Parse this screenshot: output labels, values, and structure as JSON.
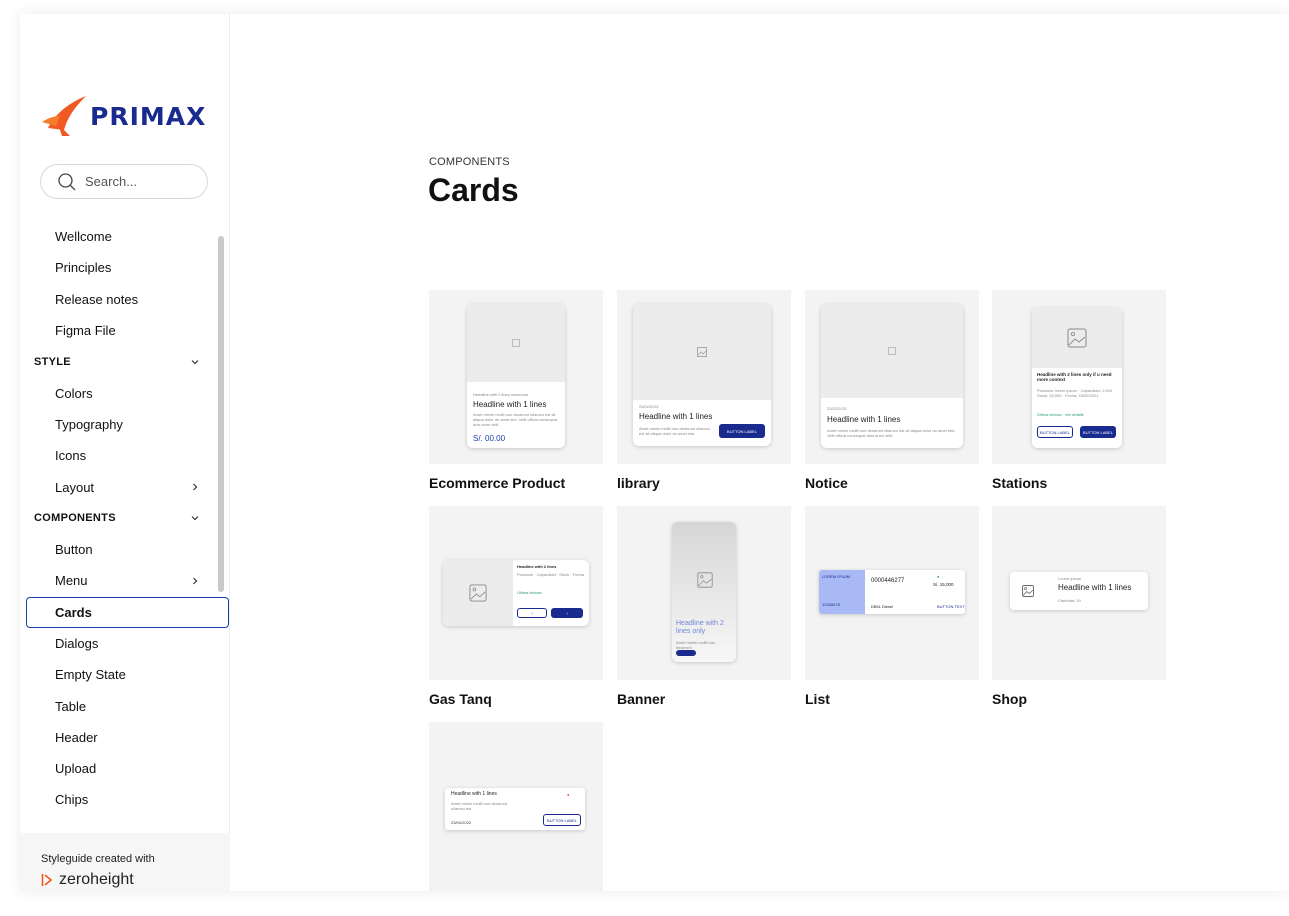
{
  "brand": {
    "name": "PRIMAX",
    "color": "#1a2b8f",
    "accent": "#f05a22"
  },
  "search": {
    "placeholder": "Search..."
  },
  "nav": {
    "intro": [
      "Wellcome",
      "Principles",
      "Release notes",
      "Figma File"
    ],
    "style_label": "STYLE",
    "style_items": [
      "Colors",
      "Typography",
      "Icons",
      "Layout"
    ],
    "components_label": "COMPONENTS",
    "component_items": [
      "Button",
      "Menu",
      "Cards",
      "Dialogs",
      "Empty State",
      "Table",
      "Header",
      "Upload",
      "Chips"
    ],
    "active": "Cards"
  },
  "footer": {
    "note": "Styleguide created with",
    "product": "zeroheight"
  },
  "page": {
    "eyebrow": "COMPONENTS",
    "title": "Cards"
  },
  "tiles": [
    {
      "label": "Ecommerce Product",
      "headline": "Headline with 1 lines",
      "price": "S/. 00.00"
    },
    {
      "label": "library",
      "headline": "Headline with 1 lines",
      "date": "23/02/2021",
      "button": "BUTTON LABEL"
    },
    {
      "label": "Notice",
      "headline": "Headline with 1 lines",
      "date": "23/02/2021"
    },
    {
      "label": "Stations",
      "headline": "Headline with 2 lines only if u need more context",
      "button_outline": "BUTTON LABEL",
      "button": "BUTTON LABEL"
    },
    {
      "label": "Gas Tanq",
      "headline": "Headline with 2 lines"
    },
    {
      "label": "Banner",
      "headline": "Headline with 2 lines only"
    },
    {
      "label": "List",
      "code": "0000446277",
      "amount": "S/. 15,000",
      "product": "DB5L Diesel",
      "button": "BUTTON TEXT"
    },
    {
      "label": "Shop",
      "eyebrow": "Lorem ipsum",
      "headline": "Headline with 1 lines",
      "qty": "Cantidad: 19"
    },
    {
      "label": "",
      "headline": "Headline with 1 lines",
      "button": "BUTTON LABEL",
      "date": "23/04/2022"
    }
  ]
}
